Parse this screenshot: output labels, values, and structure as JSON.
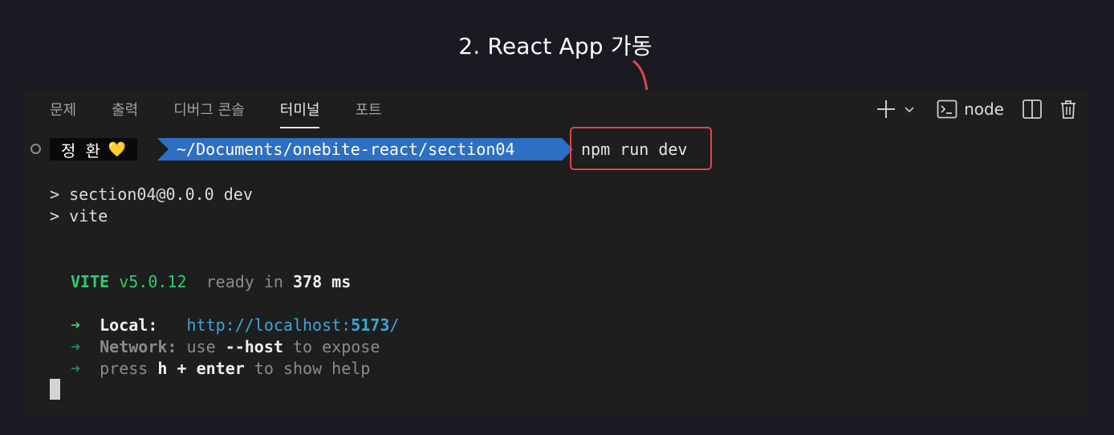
{
  "annotation": {
    "text": "2. React App 가동"
  },
  "tabs": [
    {
      "label": "문제",
      "active": false
    },
    {
      "label": "출력",
      "active": false
    },
    {
      "label": "디버그 콘솔",
      "active": false
    },
    {
      "label": "터미널",
      "active": true
    },
    {
      "label": "포트",
      "active": false
    }
  ],
  "toolbar": {
    "add_icon": "plus-icon",
    "dropdown_icon": "chevron-down-icon",
    "terminal_icon": "terminal-icon",
    "terminal_label": "node",
    "split_icon": "split-icon",
    "trash_icon": "trash-icon"
  },
  "prompt": {
    "user": "정 환",
    "emoji": "💛",
    "path": "~/Documents/onebite-react/section04",
    "command": "npm run dev"
  },
  "output": {
    "line1": "> section04@0.0.0 dev",
    "line2": "> vite",
    "vite_name": "VITE",
    "vite_version": "v5.0.12",
    "ready_text": "ready in",
    "ready_time": "378",
    "ready_unit": "ms",
    "arrow": "➜",
    "local_label": "Local:",
    "local_url_prefix": "http://localhost:",
    "local_port": "5173",
    "local_url_suffix": "/",
    "network_label": "Network:",
    "network_use": "use",
    "network_flag": "--host",
    "network_rest": "to expose",
    "help_press": "press",
    "help_h": "h + enter",
    "help_rest": "to show help"
  },
  "colors": {
    "accent_red": "#e0454a",
    "path_blue": "#2d6fc2",
    "vite_green": "#2ecc71",
    "url_cyan": "#3aa7d8"
  }
}
